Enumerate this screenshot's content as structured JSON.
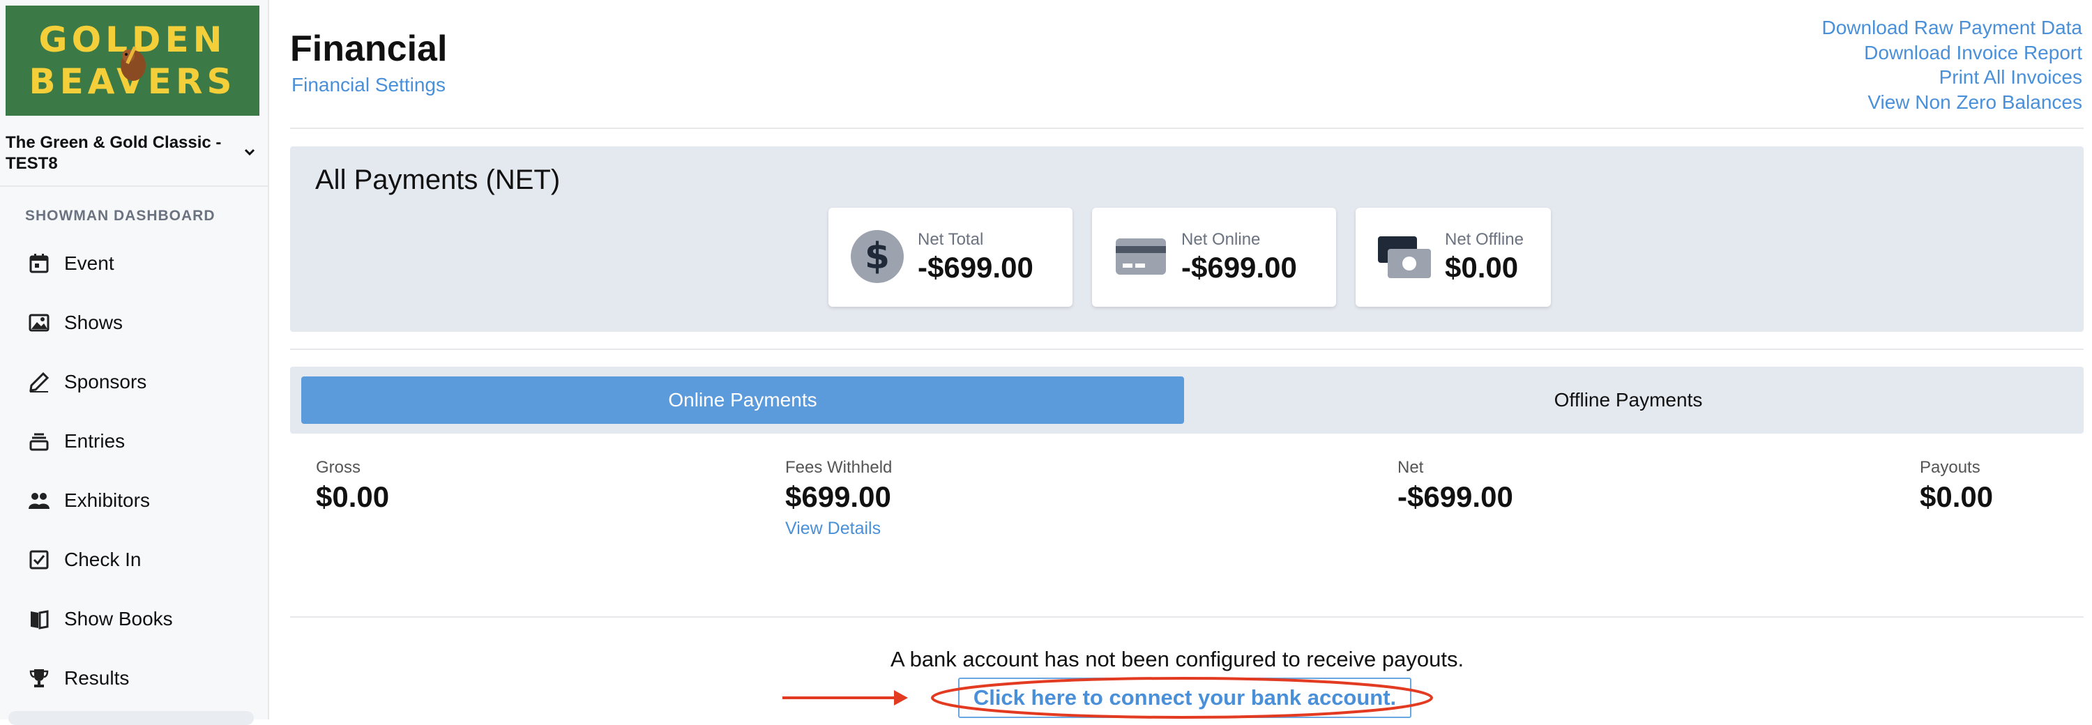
{
  "sidebar": {
    "logo_lines": [
      "GOLDEN",
      "BEAVERS"
    ],
    "event_name": "The Green & Gold Classic - TEST8",
    "section_label": "SHOWMAN DASHBOARD",
    "items": [
      {
        "label": "Event",
        "icon": "calendar-icon"
      },
      {
        "label": "Shows",
        "icon": "image-icon"
      },
      {
        "label": "Sponsors",
        "icon": "pen-icon"
      },
      {
        "label": "Entries",
        "icon": "stack-icon"
      },
      {
        "label": "Exhibitors",
        "icon": "users-icon"
      },
      {
        "label": "Check In",
        "icon": "checkbox-icon"
      },
      {
        "label": "Show Books",
        "icon": "book-icon"
      },
      {
        "label": "Results",
        "icon": "trophy-icon"
      }
    ]
  },
  "header": {
    "title": "Financial",
    "settings_link": "Financial Settings",
    "links": [
      "Download Raw Payment Data",
      "Download Invoice Report",
      "Print All Invoices",
      "View Non Zero Balances"
    ]
  },
  "summary": {
    "title": "All Payments (NET)",
    "cards": [
      {
        "label": "Net Total",
        "value": "-$699.00",
        "icon": "dollar-circle-icon"
      },
      {
        "label": "Net Online",
        "value": "-$699.00",
        "icon": "credit-card-icon"
      },
      {
        "label": "Net Offline",
        "value": "$0.00",
        "icon": "cash-icon"
      }
    ]
  },
  "tabs": {
    "online": "Online Payments",
    "offline": "Offline Payments",
    "active": "online"
  },
  "metrics": {
    "gross": {
      "label": "Gross",
      "value": "$0.00"
    },
    "fees": {
      "label": "Fees Withheld",
      "value": "$699.00",
      "link": "View Details"
    },
    "net": {
      "label": "Net",
      "value": "-$699.00"
    },
    "payouts": {
      "label": "Payouts",
      "value": "$0.00"
    }
  },
  "bank": {
    "message": "A bank account has not been configured to receive payouts.",
    "link": "Click here to connect your bank account."
  },
  "colors": {
    "link": "#4a90d9",
    "active_tab": "#5b9bdc",
    "panel": "#e4e8ef",
    "annotation": "#e23b22",
    "logo_bg": "#3b7a46",
    "logo_text": "#f4cf3a"
  }
}
